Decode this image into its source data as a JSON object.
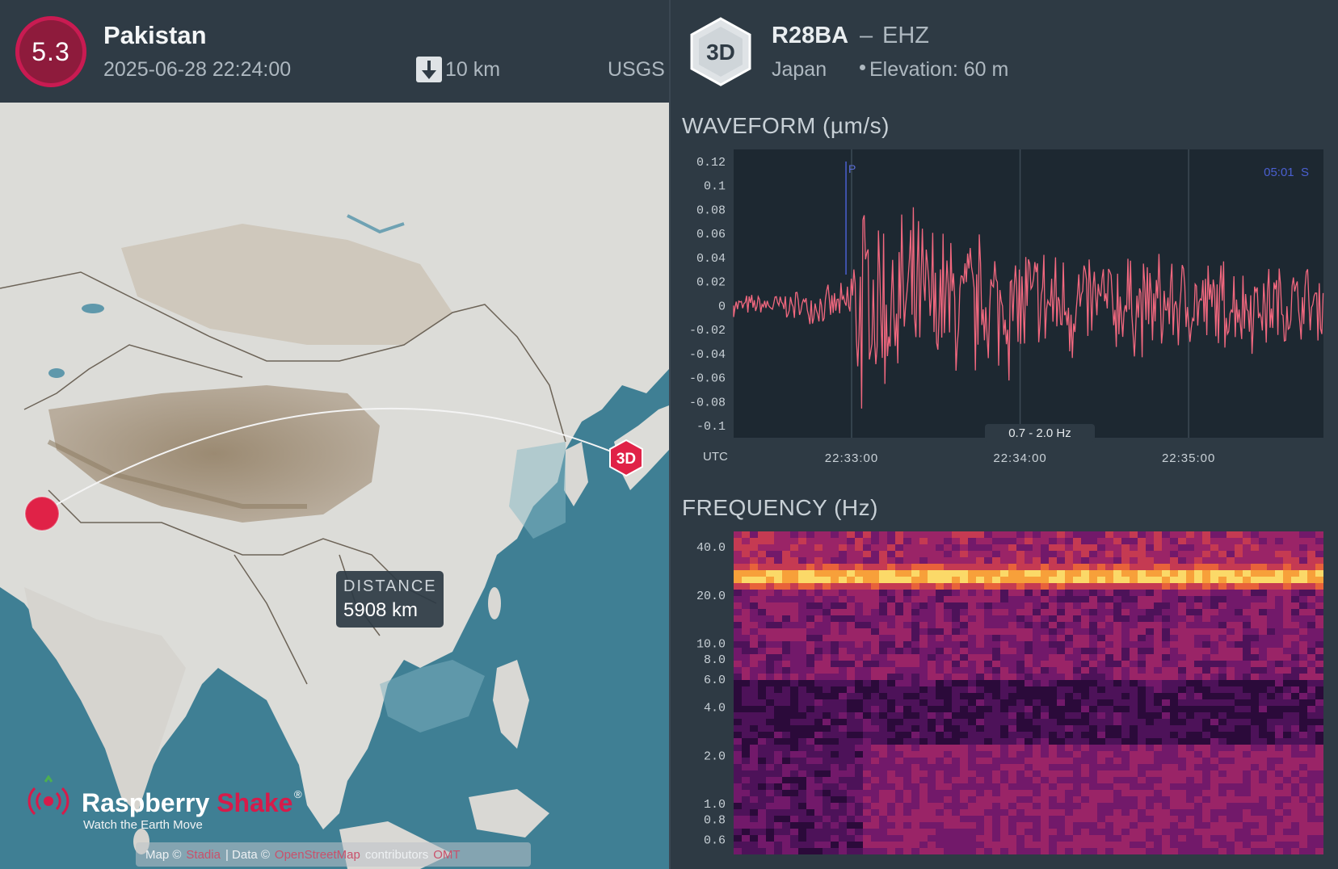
{
  "quake": {
    "magnitude": "5.3",
    "region": "Pakistan",
    "datetime": "2025-06-28 22:24:00",
    "depth": "10 km",
    "depth_icon": "arrow-down-icon",
    "source": "USGS",
    "colors": {
      "badge_fill": "#8e1b3c",
      "badge_ring": "#c91b52"
    }
  },
  "map": {
    "distance_label": "DISTANCE",
    "distance_value": "5908 km",
    "station_marker_label": "3D",
    "epicenter_color": "#e02247",
    "logo": {
      "name_part1": "Raspberry",
      "name_part2": "Shake",
      "registered": "®",
      "tagline": "Watch the Earth Move"
    },
    "attribution": {
      "map_prefix": "Map ©",
      "map_link": "Stadia",
      "sep": "| Data ©",
      "data_link": "OpenStreetMap",
      "suffix": "contributors",
      "extra": "OMT"
    }
  },
  "station": {
    "badge": "3D",
    "code": "R28BA",
    "separator": "–",
    "channel": "EHZ",
    "country": "Japan",
    "elevation": "Elevation: 60 m"
  },
  "waveform": {
    "title": "WAVEFORM (µm/s)",
    "p_label": "P",
    "s_label": "05:01  S",
    "filter_label": "0.7 - 2.0 Hz",
    "utc_label": "UTC",
    "color": "#f2687f"
  },
  "frequency": {
    "title": "FREQUENCY (Hz)"
  },
  "chart_data": [
    {
      "type": "line",
      "title": "WAVEFORM (µm/s)",
      "ylabel": "µm/s",
      "xlabel": "UTC",
      "y_ticks": [
        "0.12",
        "0.1",
        "0.08",
        "0.06",
        "0.04",
        "0.02",
        "0",
        "-0.02",
        "-0.04",
        "-0.06",
        "-0.08",
        "-0.1"
      ],
      "ylim": [
        -0.11,
        0.13
      ],
      "x_ticks": [
        "22:33:00",
        "22:34:00",
        "22:35:00"
      ],
      "xlim": [
        "22:32:18",
        "22:35:48"
      ],
      "grid": true,
      "annotations": {
        "p_arrival": "22:32:58",
        "s_arrival": "05:01"
      },
      "series": [
        {
          "x": [
            "22:32:18",
            "22:32:40",
            "22:32:58",
            "22:33:03",
            "22:33:10",
            "22:33:30",
            "22:33:50",
            "22:34:00",
            "22:34:20",
            "22:34:40",
            "22:35:00",
            "22:35:20",
            "22:35:48"
          ],
          "values": [
            0.01,
            0.015,
            0.02,
            0.12,
            -0.1,
            0.085,
            0.07,
            -0.07,
            0.06,
            0.05,
            0.05,
            0.045,
            0.04
          ]
        }
      ]
    },
    {
      "type": "heatmap",
      "title": "FREQUENCY (Hz)",
      "ylabel": "Hz",
      "y_ticks": [
        "40.0",
        "20.0",
        "10.0",
        "8.0",
        "6.0",
        "4.0",
        "2.0",
        "1.0",
        "0.8",
        "0.6"
      ],
      "ylim": [
        0.5,
        50
      ],
      "log_scale": true,
      "x_range": [
        "22:32:18",
        "22:35:48"
      ],
      "features": {
        "strong_band_hz": 27,
        "low_freq_energy_after": "22:33:03"
      }
    }
  ]
}
